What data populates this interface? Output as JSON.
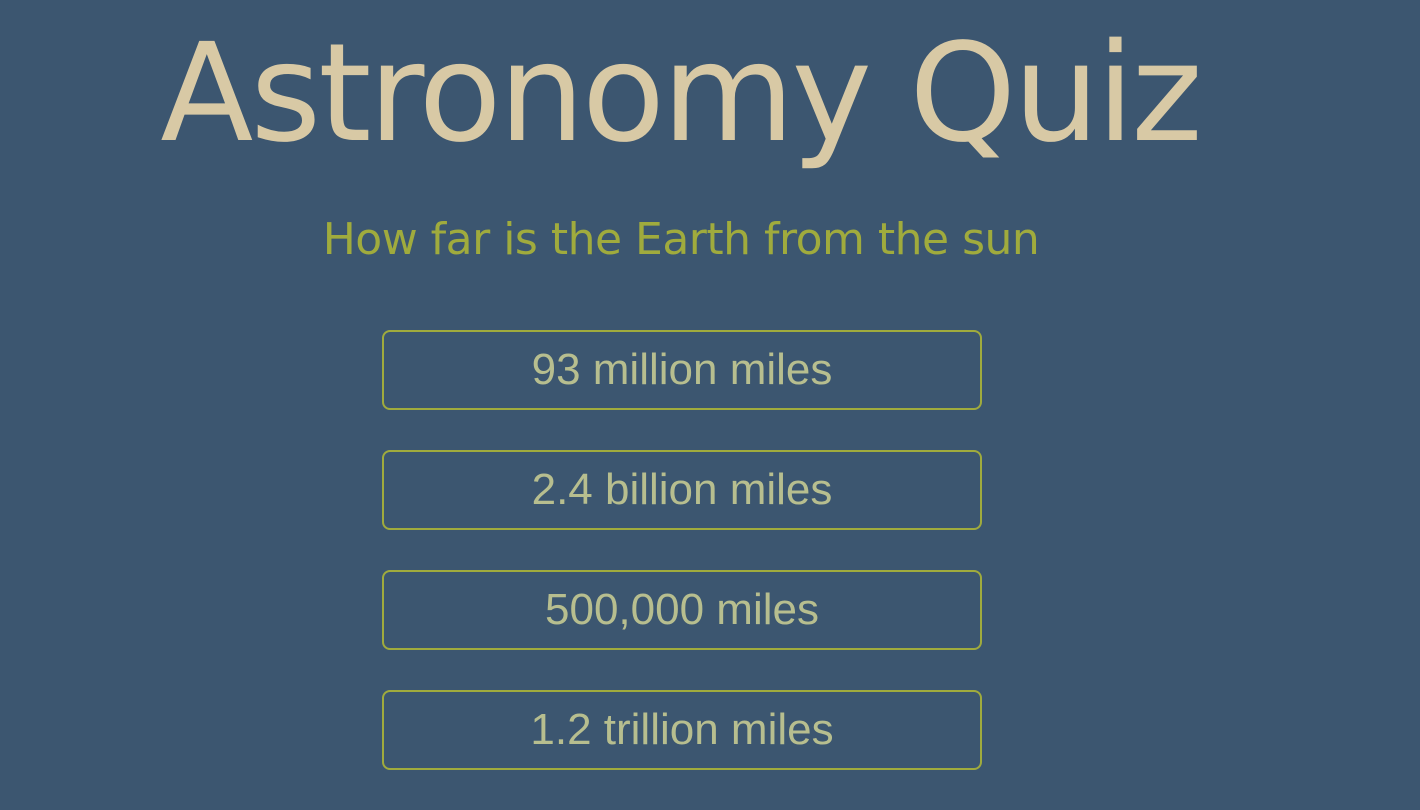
{
  "quiz": {
    "title": "Astronomy Quiz",
    "question": "How far is the Earth from the sun",
    "answers": [
      "93 million miles",
      "2.4 billion miles",
      "500,000 miles",
      "1.2 trillion miles"
    ]
  },
  "colors": {
    "background": "#3c5670",
    "title": "#d8c9a5",
    "question": "#a0ab3d",
    "answer_text": "#b7be8f",
    "answer_border": "#a0ab3d"
  }
}
